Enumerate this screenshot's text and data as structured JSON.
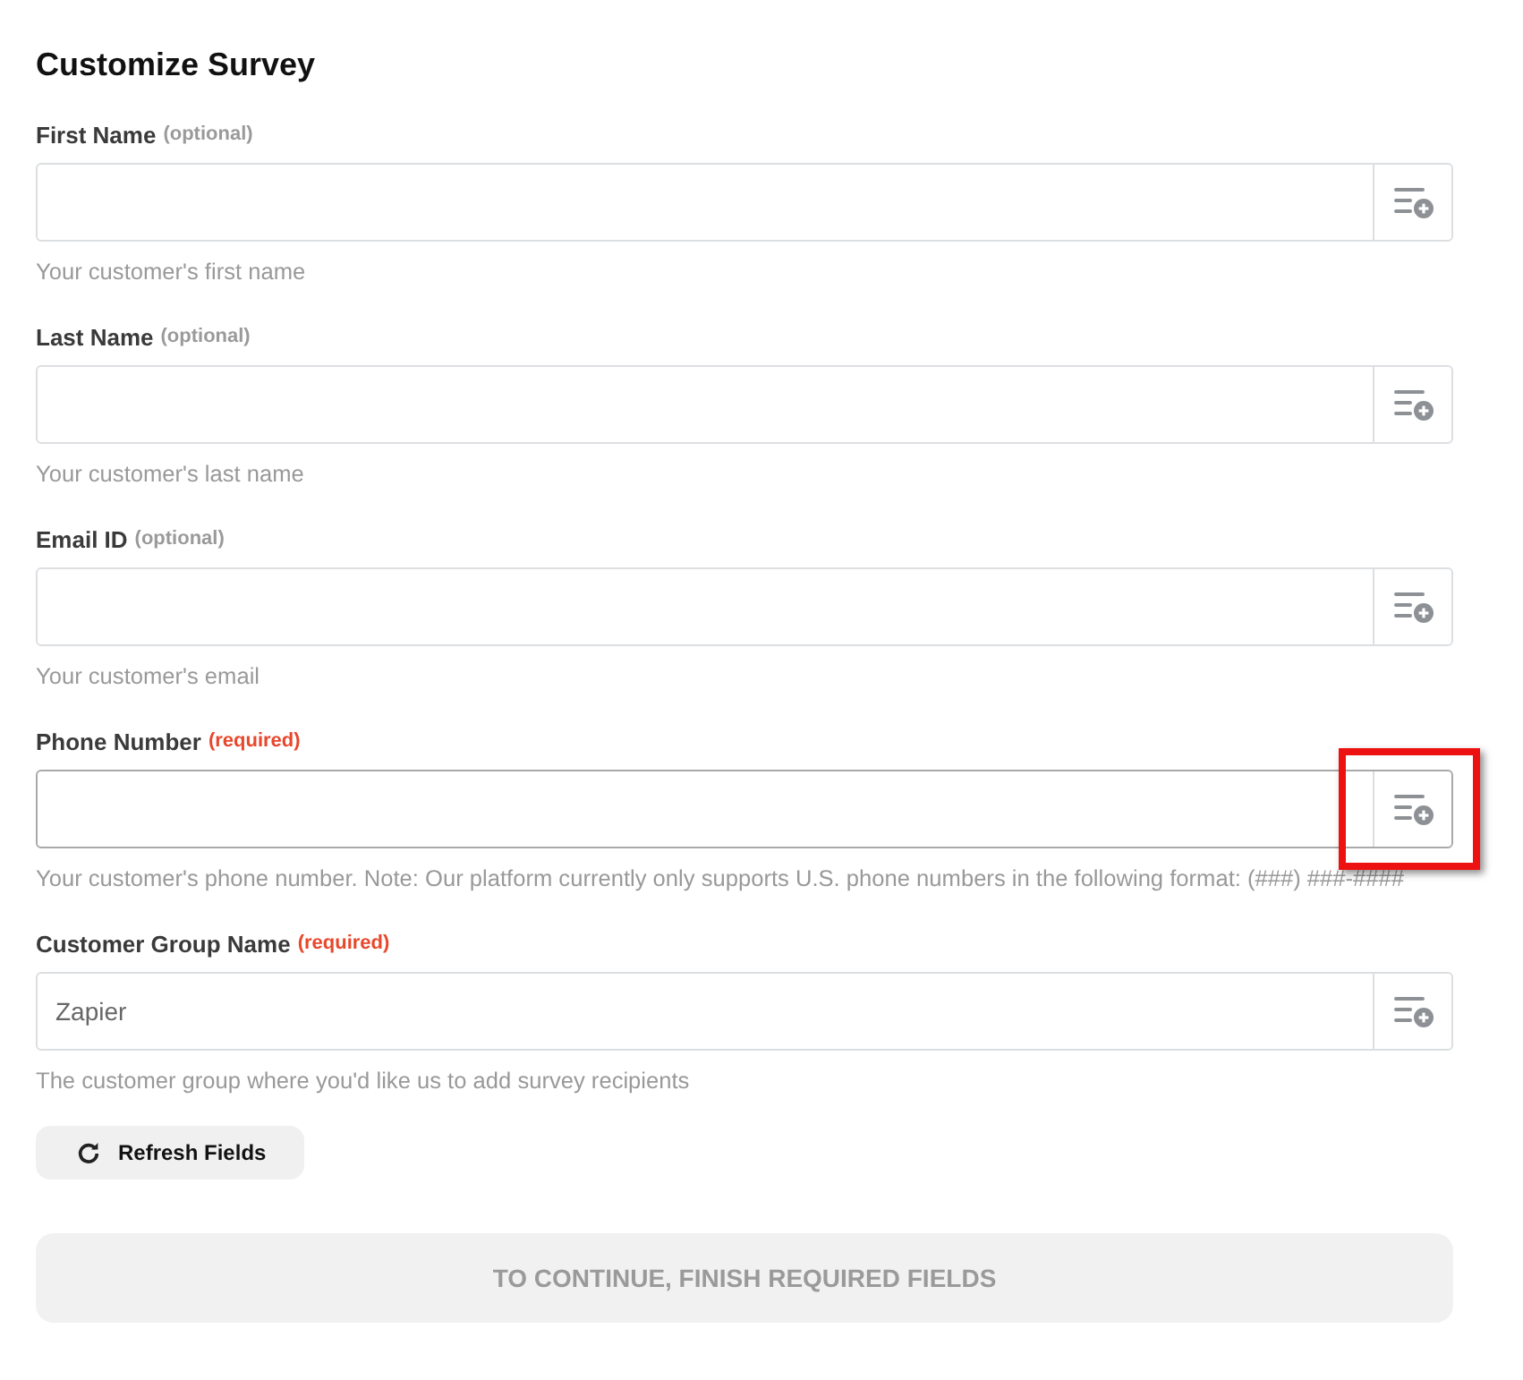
{
  "title": "Customize Survey",
  "fields": [
    {
      "label": "First Name",
      "tag": {
        "text": "(optional)",
        "kind": "optional"
      },
      "hint": "Your customer's first name",
      "focused": false,
      "highlighted": false
    },
    {
      "label": "Last Name",
      "tag": {
        "text": "(optional)",
        "kind": "optional"
      },
      "hint": "Your customer's last name",
      "focused": false,
      "highlighted": false
    },
    {
      "label": "Email ID",
      "tag": {
        "text": "(optional)",
        "kind": "optional"
      },
      "hint": "Your customer's email",
      "focused": false,
      "highlighted": false
    },
    {
      "label": "Phone Number",
      "tag": {
        "text": "(required)",
        "kind": "required"
      },
      "hint": "Your customer's phone number. Note: Our platform currently only supports U.S. phone numbers in the following format: (###) ###-####",
      "focused": true,
      "highlighted": true
    },
    {
      "label": "Customer Group Name",
      "tag": {
        "text": "(required)",
        "kind": "required"
      },
      "value": "Zapier",
      "hint": "The customer group where you'd like us to add survey recipients",
      "focused": false,
      "highlighted": false
    }
  ],
  "refresh_button": {
    "label": "Refresh Fields"
  },
  "continue_button": {
    "label": "TO CONTINUE, FINISH REQUIRED FIELDS",
    "disabled": true
  }
}
